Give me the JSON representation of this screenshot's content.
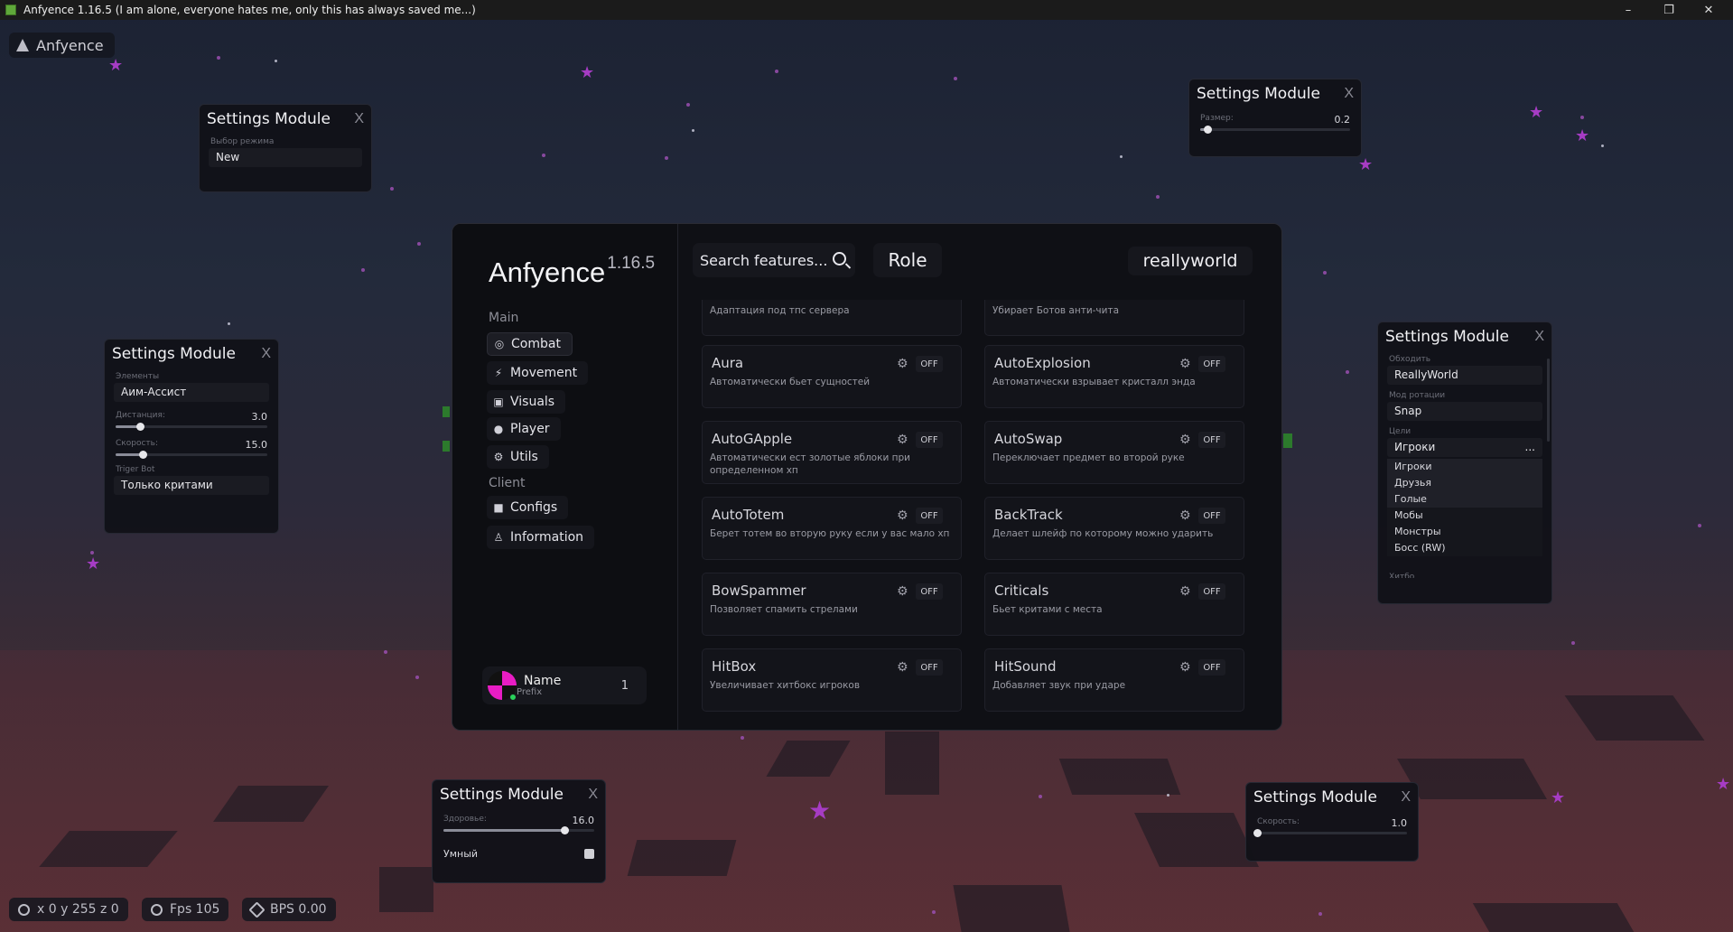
{
  "window": {
    "title": "Anfyence 1.16.5 (I am alone, everyone hates me, only this has always saved me...)",
    "minimize": "–",
    "maximize": "❐",
    "close": "✕"
  },
  "watermark": {
    "text": "Anfyence"
  },
  "settings_windows": [
    {
      "id": "sw1",
      "title": "Settings Module",
      "close": "X",
      "label": "Выбор режима",
      "value": "New"
    },
    {
      "id": "sw2",
      "title": "Settings Module",
      "close": "X",
      "slider_label": "Размер:",
      "slider_value": "0.2",
      "slider_fraction": 0.05
    },
    {
      "id": "sw3",
      "title": "Settings Module",
      "close": "X",
      "elements_label": "Элементы",
      "elements_value": "Аим-Ассист",
      "dist_label": "Дистанция:",
      "dist_value": "3.0",
      "dist_fraction": 0.16,
      "speed_label": "Скорость:",
      "speed_value": "15.0",
      "speed_fraction": 0.18,
      "trigger_label": "Triger Bot",
      "trigger_value": "Только критами"
    },
    {
      "id": "sw4",
      "title": "Settings Module",
      "close": "X",
      "bypass_label": "Обходить",
      "bypass_value": "ReallyWorld",
      "rotation_label": "Мод ротации",
      "rotation_value": "Snap",
      "targets_label": "Цели",
      "targets_value": "Игроки",
      "targets_more": "...",
      "targets_options": [
        "Игроки",
        "Друзья",
        "Голые",
        "Мобы",
        "Монстры",
        "Босс (RW)"
      ],
      "cut_label": "Хитбо"
    },
    {
      "id": "sw5",
      "title": "Settings Module",
      "close": "X",
      "health_label": "Здоровье:",
      "health_value": "16.0",
      "health_fraction": 0.8,
      "smart_label": "Умный"
    },
    {
      "id": "sw6",
      "title": "Settings Module",
      "close": "X",
      "speed_label": "Скорость:",
      "speed_value": "1.0",
      "speed_fraction": 0.0
    }
  ],
  "gui": {
    "brand": "Anfyence",
    "version": "1.16.5",
    "section_main": "Main",
    "section_client": "Client",
    "nav": {
      "combat": "Combat",
      "movement": "Movement",
      "visuals": "Visuals",
      "player": "Player",
      "utils": "Utils",
      "configs": "Configs",
      "information": "Information"
    },
    "profile": {
      "name": "Name",
      "prefix": "Prefix",
      "count": "1"
    },
    "search_placeholder": "Search features...",
    "role": "Role",
    "server": "reallyworld",
    "off_label": "OFF",
    "partial_left": "Адаптация под тпс сервера",
    "partial_right": "Убирает Ботов анти-чита",
    "modules": [
      {
        "name": "Aura",
        "desc": "Автоматически бьет сущностей"
      },
      {
        "name": "AutoExplosion",
        "desc": "Автоматически взрывает кристалл энда"
      },
      {
        "name": "AutoGApple",
        "desc": "Автоматически ест золотые яблоки при определенном хп"
      },
      {
        "name": "AutoSwap",
        "desc": "Переключает предмет во второй руке"
      },
      {
        "name": "AutoTotem",
        "desc": "Берет тотем во вторую руку если у вас мало хп"
      },
      {
        "name": "BackTrack",
        "desc": "Делает шлейф по которому можно ударить"
      },
      {
        "name": "BowSpammer",
        "desc": "Позволяет спамить стрелами"
      },
      {
        "name": "Criticals",
        "desc": "Бьет критами с места"
      },
      {
        "name": "HitBox",
        "desc": "Увеличивает хитбокс игроков"
      },
      {
        "name": "HitSound",
        "desc": "Добавляет звук при ударе"
      }
    ]
  },
  "stats": {
    "coords": "x 0 y 255 z 0",
    "fps": "Fps 105",
    "bps": "BPS 0.00"
  }
}
